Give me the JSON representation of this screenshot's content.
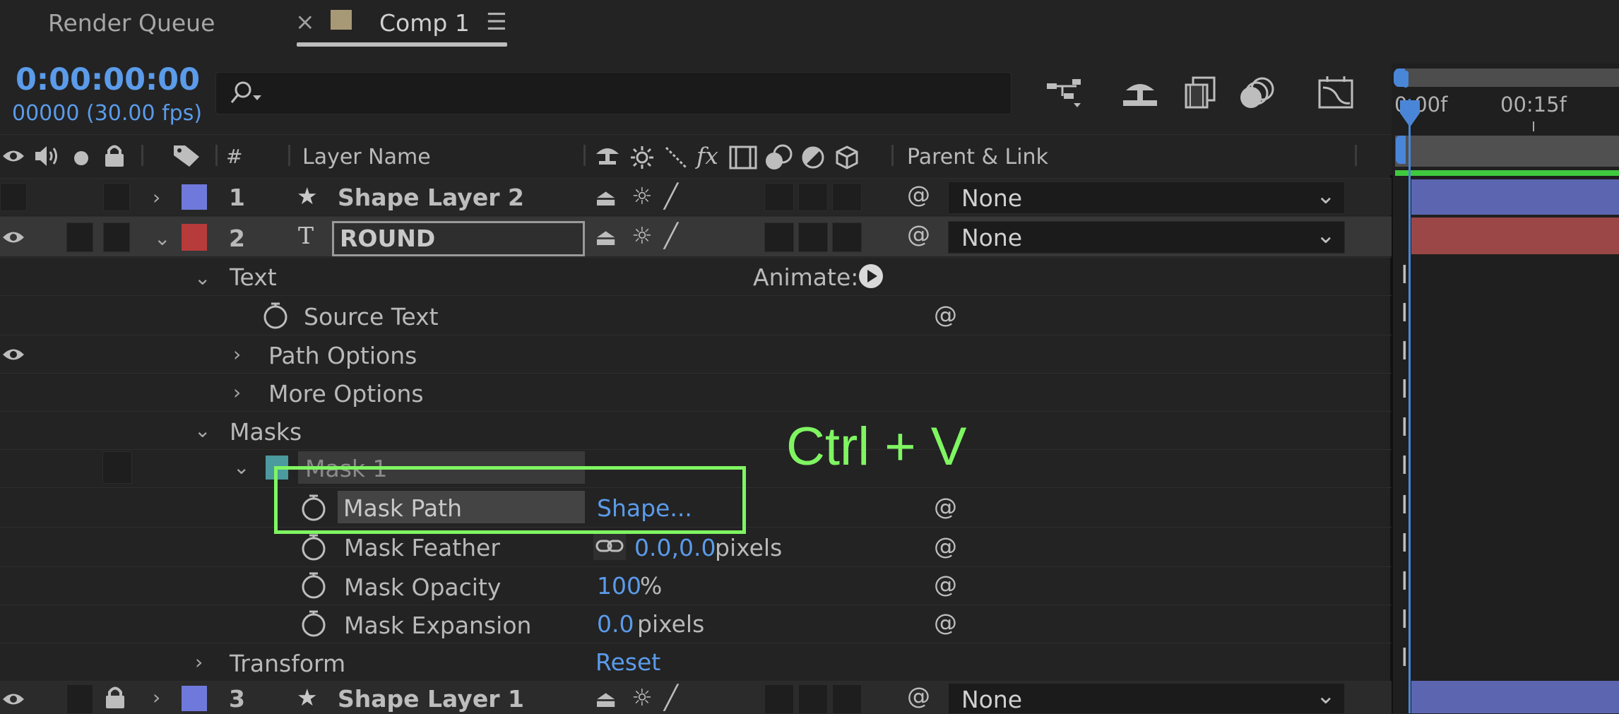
{
  "tabs": {
    "render_queue": "Render Queue",
    "close": "×",
    "comp": "Comp 1",
    "menu": "☰"
  },
  "time": {
    "timecode": "0:00:00:00",
    "frames": "00000 (30.00 fps)"
  },
  "search": {
    "placeholder": "",
    "icon": "search-icon"
  },
  "ruler": {
    "t0": "0:00f",
    "t1": "00:15f"
  },
  "columns": {
    "num": "#",
    "layer_name": "Layer Name",
    "fx": "fx",
    "parent_link": "Parent & Link"
  },
  "layers": [
    {
      "num": "1",
      "icon": "★",
      "name": "Shape Layer 2",
      "color": "#6f79db",
      "parent": "None"
    },
    {
      "num": "2",
      "icon": "T",
      "name": "ROUND",
      "color": "#b83b3b",
      "parent": "None"
    },
    {
      "num": "3",
      "icon": "★",
      "name": "Shape Layer 1",
      "color": "#6f79db",
      "parent": "None"
    }
  ],
  "props": {
    "text": "Text",
    "animate": "Animate:",
    "source_text": "Source Text",
    "path_options": "Path Options",
    "more_options": "More Options",
    "masks": "Masks",
    "mask1": "Mask 1",
    "mask_path": "Mask Path",
    "mask_path_value": "Shape...",
    "mask_feather": "Mask Feather",
    "mask_feather_value": "0.0,0.0",
    "mask_feather_unit": "pixels",
    "mask_opacity": "Mask Opacity",
    "mask_opacity_value": "100",
    "mask_opacity_unit": "%",
    "mask_expansion": "Mask Expansion",
    "mask_expansion_value": "0.0",
    "mask_expansion_unit": "pixels",
    "transform": "Transform",
    "transform_reset": "Reset"
  },
  "annotation": {
    "text": "Ctrl + V",
    "color": "#7ff562"
  },
  "colors": {
    "accent": "#5b9bea",
    "label_shape": "#6f79db",
    "label_text": "#b83b3b",
    "mask": "#4a9a9e"
  }
}
